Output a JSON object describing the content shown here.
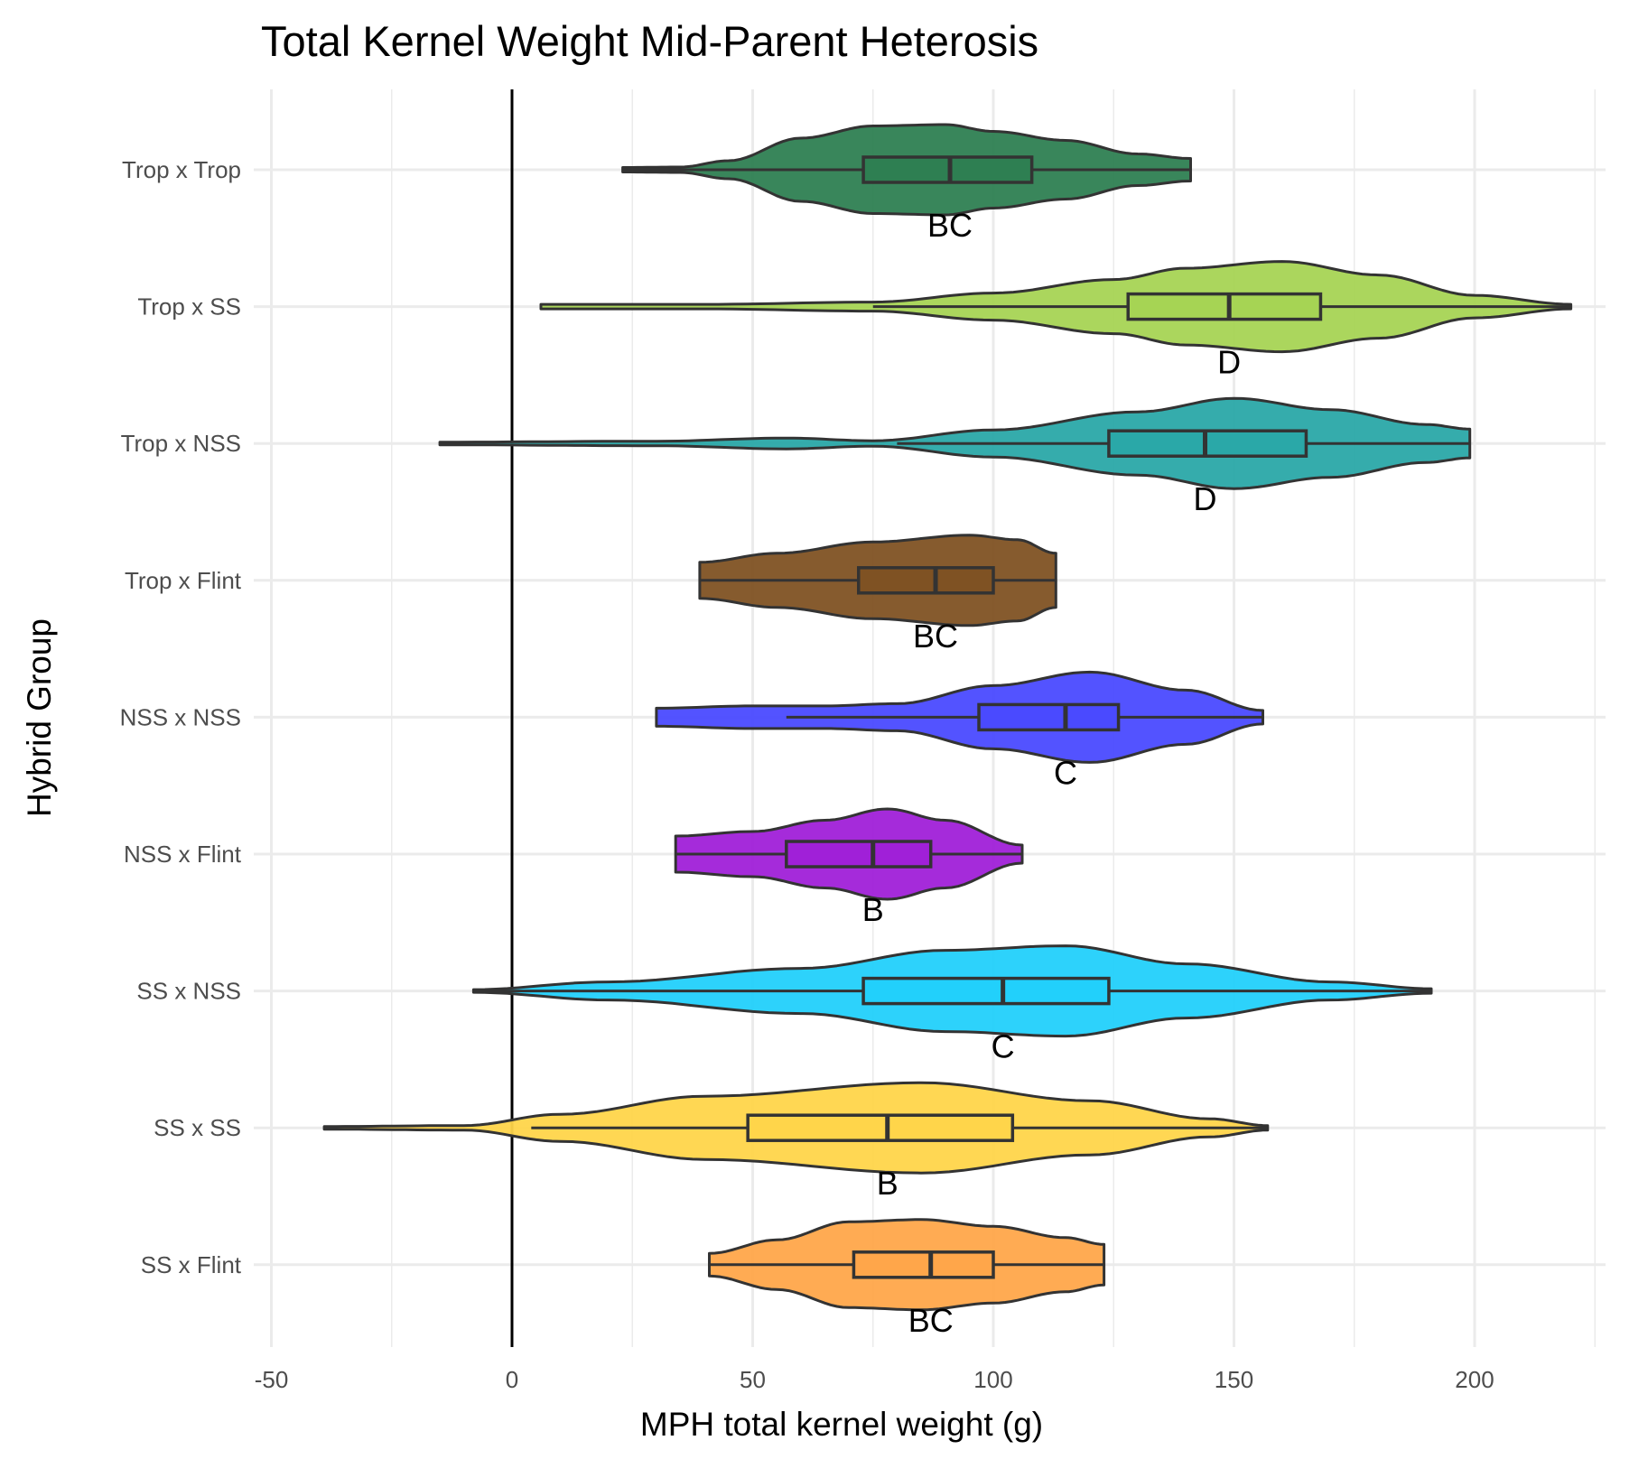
{
  "chart_data": {
    "type": "violin",
    "title": "Total Kernel Weight Mid-Parent Heterosis",
    "xlabel": "MPH total kernel weight (g)",
    "ylabel": "Hybrid Group",
    "xlim": [
      -50,
      230
    ],
    "xticks": [
      -50,
      0,
      50,
      100,
      150,
      200
    ],
    "xtick_labels": [
      "-50",
      "0",
      "50",
      "100",
      "150",
      "200"
    ],
    "reference_line_x": 0,
    "grid": true,
    "groups": [
      {
        "name": "Trop x Trop",
        "color": "#2e7f52",
        "min": 23,
        "max": 141,
        "whisker_low": 23,
        "whisker_high": 141,
        "q1": 73,
        "median": 91,
        "q3": 108,
        "letter": "BC",
        "density": [
          [
            23,
            0.05
          ],
          [
            35,
            0.06
          ],
          [
            45,
            0.2
          ],
          [
            60,
            0.7
          ],
          [
            75,
            0.97
          ],
          [
            90,
            1
          ],
          [
            100,
            0.85
          ],
          [
            115,
            0.65
          ],
          [
            130,
            0.35
          ],
          [
            141,
            0.25
          ]
        ]
      },
      {
        "name": "Trop x SS",
        "color": "#a6d454",
        "min": 6,
        "max": 220,
        "whisker_low": 75,
        "whisker_high": 220,
        "q1": 128,
        "median": 149,
        "q3": 168,
        "letter": "D",
        "density": [
          [
            6,
            0.05
          ],
          [
            40,
            0.05
          ],
          [
            75,
            0.1
          ],
          [
            100,
            0.3
          ],
          [
            125,
            0.6
          ],
          [
            140,
            0.85
          ],
          [
            160,
            1
          ],
          [
            180,
            0.7
          ],
          [
            200,
            0.25
          ],
          [
            220,
            0.05
          ]
        ]
      },
      {
        "name": "Trop x NSS",
        "color": "#2aa8a8",
        "min": -15,
        "max": 199,
        "whisker_low": 80,
        "whisker_high": 199,
        "q1": 124,
        "median": 144,
        "q3": 165,
        "letter": "D",
        "density": [
          [
            -15,
            0.03
          ],
          [
            30,
            0.05
          ],
          [
            57,
            0.12
          ],
          [
            75,
            0.06
          ],
          [
            100,
            0.3
          ],
          [
            130,
            0.7
          ],
          [
            150,
            1
          ],
          [
            170,
            0.75
          ],
          [
            190,
            0.42
          ],
          [
            199,
            0.32
          ]
        ]
      },
      {
        "name": "Trop x Flint",
        "color": "#7f5223",
        "min": 39,
        "max": 113,
        "whisker_low": 39,
        "whisker_high": 113,
        "q1": 72,
        "median": 88,
        "q3": 100,
        "letter": "BC",
        "density": [
          [
            39,
            0.4
          ],
          [
            55,
            0.6
          ],
          [
            75,
            0.85
          ],
          [
            95,
            1
          ],
          [
            105,
            0.9
          ],
          [
            113,
            0.6
          ]
        ]
      },
      {
        "name": "NSS x NSS",
        "color": "#4a4aff",
        "min": 30,
        "max": 156,
        "whisker_low": 57,
        "whisker_high": 156,
        "q1": 97,
        "median": 115,
        "q3": 126,
        "letter": "C",
        "density": [
          [
            30,
            0.2
          ],
          [
            50,
            0.25
          ],
          [
            65,
            0.25
          ],
          [
            80,
            0.3
          ],
          [
            100,
            0.7
          ],
          [
            120,
            1
          ],
          [
            140,
            0.6
          ],
          [
            156,
            0.15
          ]
        ]
      },
      {
        "name": "NSS x Flint",
        "color": "#a020d8",
        "min": 34,
        "max": 106,
        "whisker_low": 34,
        "whisker_high": 106,
        "q1": 57,
        "median": 75,
        "q3": 87,
        "letter": "B",
        "density": [
          [
            34,
            0.4
          ],
          [
            50,
            0.5
          ],
          [
            65,
            0.75
          ],
          [
            78,
            1
          ],
          [
            90,
            0.75
          ],
          [
            106,
            0.2
          ]
        ]
      },
      {
        "name": "SS x NSS",
        "color": "#22d0fb",
        "min": -8,
        "max": 191,
        "whisker_low": -8,
        "whisker_high": 191,
        "q1": 73,
        "median": 102,
        "q3": 124,
        "letter": "C",
        "density": [
          [
            -8,
            0.03
          ],
          [
            20,
            0.2
          ],
          [
            60,
            0.5
          ],
          [
            90,
            0.9
          ],
          [
            115,
            1
          ],
          [
            140,
            0.6
          ],
          [
            170,
            0.2
          ],
          [
            191,
            0.05
          ]
        ]
      },
      {
        "name": "SS x SS",
        "color": "#ffd54a",
        "min": -39,
        "max": 157,
        "whisker_low": 4,
        "whisker_high": 157,
        "q1": 49,
        "median": 78,
        "q3": 104,
        "letter": "B",
        "density": [
          [
            -39,
            0.03
          ],
          [
            -10,
            0.05
          ],
          [
            10,
            0.3
          ],
          [
            40,
            0.7
          ],
          [
            85,
            1
          ],
          [
            120,
            0.6
          ],
          [
            145,
            0.2
          ],
          [
            157,
            0.05
          ]
        ]
      },
      {
        "name": "SS x Flint",
        "color": "#ffa64a",
        "min": 41,
        "max": 123,
        "whisker_low": 41,
        "whisker_high": 123,
        "q1": 71,
        "median": 87,
        "q3": 100,
        "letter": "BC",
        "density": [
          [
            41,
            0.25
          ],
          [
            55,
            0.55
          ],
          [
            70,
            0.95
          ],
          [
            85,
            1
          ],
          [
            100,
            0.85
          ],
          [
            115,
            0.6
          ],
          [
            123,
            0.45
          ]
        ]
      }
    ]
  }
}
